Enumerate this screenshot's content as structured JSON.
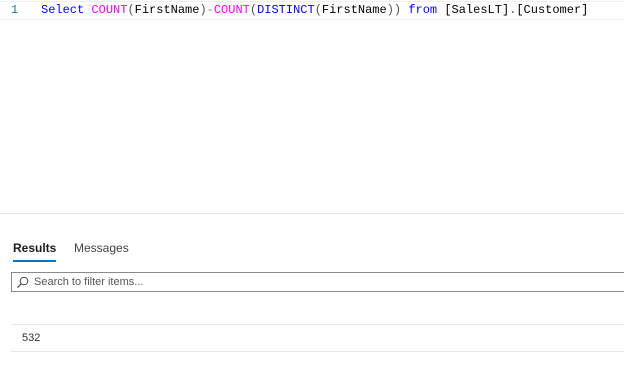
{
  "editor": {
    "line_number": "1",
    "tokens": {
      "select": "Select",
      "count1": "COUNT",
      "open1": "(",
      "col1": "FirstName",
      "close1": ")",
      "minus": "-",
      "count2": "COUNT",
      "open2": "(",
      "distinct": "DISTINCT",
      "open3": "(",
      "col2": "FirstName",
      "close2": "))",
      "space1": " ",
      "from": "from",
      "space2": " ",
      "schema": "[SalesLT]",
      "dot": ".",
      "table": "[Customer]"
    }
  },
  "tabs": {
    "results": "Results",
    "messages": "Messages"
  },
  "search": {
    "placeholder": "Search to filter items..."
  },
  "results": {
    "rows": [
      [
        "532"
      ]
    ]
  },
  "colors": {
    "keyword": "#0000ff",
    "function": "#ff00ff",
    "operator": "#808080",
    "line_number": "#237893",
    "tab_accent": "#0078d4"
  },
  "icons": {
    "search": "search-icon"
  }
}
